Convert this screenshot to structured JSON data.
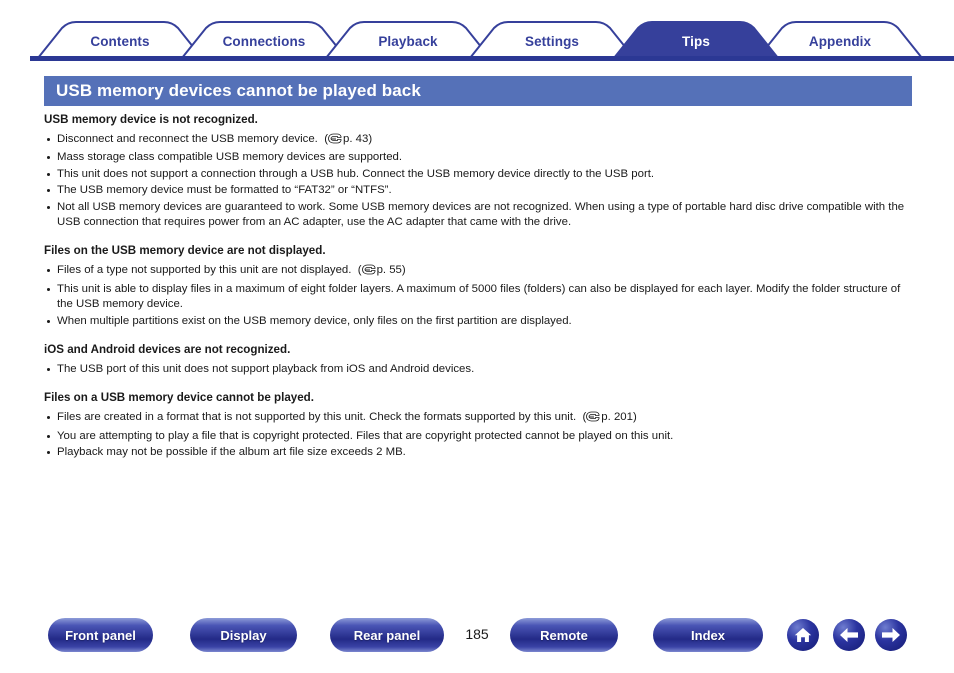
{
  "tabs": [
    {
      "label": "Contents",
      "active": false
    },
    {
      "label": "Connections",
      "active": false
    },
    {
      "label": "Playback",
      "active": false
    },
    {
      "label": "Settings",
      "active": false
    },
    {
      "label": "Tips",
      "active": true
    },
    {
      "label": "Appendix",
      "active": false
    }
  ],
  "page_title": "USB memory devices cannot be played back",
  "sections": [
    {
      "heading": "USB memory device is not recognized.",
      "items": [
        {
          "text": "Disconnect and reconnect the USB memory device.",
          "ref": "p. 43"
        },
        {
          "text": "Mass storage class compatible USB memory devices are supported.",
          "ref": ""
        },
        {
          "text": "This unit does not support a connection through a USB hub. Connect the USB memory device directly to the USB port.",
          "ref": ""
        },
        {
          "text": "The USB memory device must be formatted to “FAT32” or “NTFS”.",
          "ref": ""
        },
        {
          "text": "Not all USB memory devices are guaranteed to work. Some USB memory devices are not recognized. When using a type of portable hard disc drive compatible with the USB connection that requires power from an AC adapter, use the AC adapter that came with the drive.",
          "ref": ""
        }
      ]
    },
    {
      "heading": "Files on the USB memory device are not displayed.",
      "items": [
        {
          "text": "Files of a type not supported by this unit are not displayed.",
          "ref": "p. 55"
        },
        {
          "text": "This unit is able to display files in a maximum of eight folder layers. A maximum of 5000 files (folders) can also be displayed for each layer. Modify the folder structure of the USB memory device.",
          "ref": ""
        },
        {
          "text": "When multiple partitions exist on the USB memory device, only files on the first partition are displayed.",
          "ref": ""
        }
      ]
    },
    {
      "heading": "iOS and Android devices are not recognized.",
      "items": [
        {
          "text": "The USB port of this unit does not support playback from iOS and Android devices.",
          "ref": ""
        }
      ]
    },
    {
      "heading": "Files on a USB memory device cannot be played.",
      "items": [
        {
          "text": "Files are created in a format that is not supported by this unit. Check the formats supported by this unit.",
          "ref": "p. 201"
        },
        {
          "text": "You are attempting to play a file that is copyright protected. Files that are copyright protected cannot be played on this unit.",
          "ref": ""
        },
        {
          "text": "Playback may not be possible if the album art file size exceeds 2 MB.",
          "ref": ""
        }
      ]
    }
  ],
  "footer": {
    "buttons": [
      {
        "label": "Front panel"
      },
      {
        "label": "Display"
      },
      {
        "label": "Rear panel"
      },
      {
        "label": "Remote"
      },
      {
        "label": "Index"
      }
    ],
    "page_number": "185",
    "icon_buttons": [
      {
        "name": "home-icon"
      },
      {
        "name": "back-arrow-icon"
      },
      {
        "name": "forward-arrow-icon"
      }
    ]
  },
  "colors": {
    "tab_outline": "#36409b",
    "tab_active_fill": "#36409b",
    "title_bar": "#5571b8",
    "underline": "#2b3894",
    "text": "#1a1a1a"
  }
}
